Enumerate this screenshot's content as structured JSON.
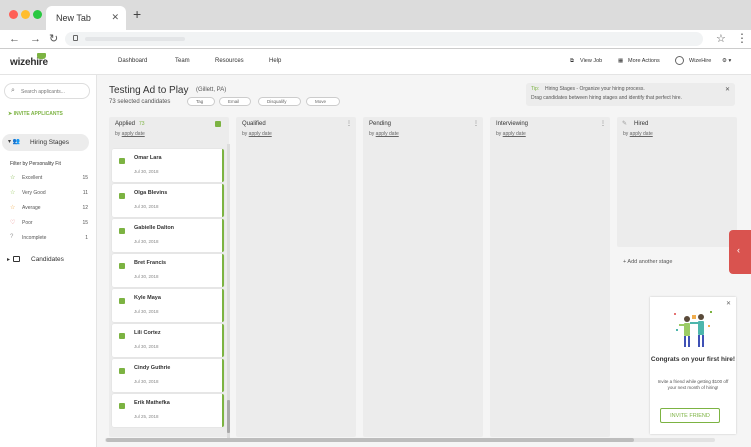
{
  "browser": {
    "tab_title": "New Tab",
    "tab_close": "✕",
    "new_tab": "+",
    "nav": {
      "back": "←",
      "forward": "→",
      "reload": "↻"
    },
    "icons": {
      "lock": "lock-icon",
      "star": "star-icon",
      "menu": "more-vert-icon"
    },
    "star": "☆",
    "menu": "⋮"
  },
  "header": {
    "logo": "wizehire",
    "nav": [
      "Dashboard",
      "Team",
      "Resources",
      "Help"
    ],
    "view_job": "View Job",
    "more_actions": "More Actions",
    "account": "WizeHire",
    "settings": "⚙ ▾",
    "colors": {
      "brand_green": "#7cb342"
    }
  },
  "sidebar": {
    "search_placeholder": "Search applicants...",
    "invite": "INVITE APPLICANTS",
    "hiring_stages": "Hiring Stages",
    "filter_title": "Filter by Personality Fit",
    "fit": [
      {
        "label": "Excellent",
        "count": "15",
        "icon": "☆",
        "color": "#7cb342"
      },
      {
        "label": "Very Good",
        "count": "11",
        "icon": "☆",
        "color": "#9ccc65"
      },
      {
        "label": "Average",
        "count": "12",
        "icon": "☆",
        "color": "#f0ad4e"
      },
      {
        "label": "Poor",
        "count": "15",
        "icon": "♡",
        "color": "#e57373"
      },
      {
        "label": "Incomplete",
        "count": "1",
        "icon": "?",
        "color": "#999999"
      }
    ],
    "candidates": "Candidates"
  },
  "board": {
    "title": "Testing Ad to Play",
    "location": "(Gillett, PA)",
    "selected": "73 selected candidates",
    "actions": [
      "Tag",
      "Email",
      "Disqualify",
      "Move"
    ],
    "tip": {
      "label": "Tip:",
      "line1": "Hiring Stages - Organize your hiring process.",
      "line2": "Drag candidates between hiring stages and identify that perfect hire.",
      "close": "✕"
    },
    "columns": [
      {
        "title": "Applied",
        "count": "73",
        "sort_prefix": "by",
        "sort": "apply date"
      },
      {
        "title": "Qualified",
        "sort_prefix": "by",
        "sort": "apply date"
      },
      {
        "title": "Pending",
        "sort_prefix": "by",
        "sort": "apply date"
      },
      {
        "title": "Interviewing",
        "sort_prefix": "by",
        "sort": "apply date"
      },
      {
        "title": "Hired",
        "sort_prefix": "by",
        "sort": "apply date"
      }
    ],
    "cards": [
      {
        "name": "Omar Lara",
        "date": "Jul 30, 2018"
      },
      {
        "name": "Olga Blevins",
        "date": "Jul 30, 2018"
      },
      {
        "name": "Gabielle Dalton",
        "date": "Jul 30, 2018"
      },
      {
        "name": "Bret Francis",
        "date": "Jul 30, 2018"
      },
      {
        "name": "Kyle Maya",
        "date": "Jul 30, 2018"
      },
      {
        "name": "Lili Cortez",
        "date": "Jul 30, 2018"
      },
      {
        "name": "Cindy Guthrie",
        "date": "Jul 30, 2018"
      },
      {
        "name": "Erik Mathefka",
        "date": "Jul 25, 2018"
      }
    ],
    "add_stage": "+   Add another stage",
    "side_tab": "‹"
  },
  "promo": {
    "close": "✕",
    "title": "Congrats on your first hire!",
    "body": "Invite a friend while getting $100 off your next month of hiring!",
    "button": "INVITE FRIEND"
  }
}
